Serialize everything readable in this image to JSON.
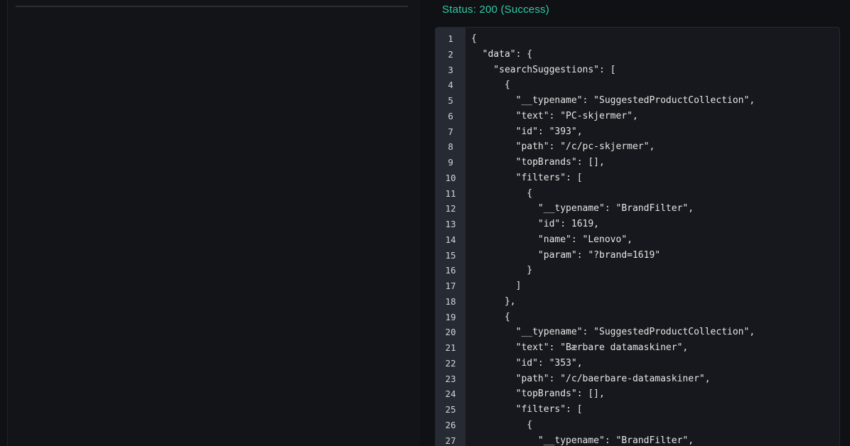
{
  "status": {
    "text": "Status: 200 (Success)",
    "color": "#33c9a5"
  },
  "editor": {
    "lines": [
      {
        "number": "1",
        "text": "{"
      },
      {
        "number": "2",
        "text": "  \"data\": {"
      },
      {
        "number": "3",
        "text": "    \"searchSuggestions\": ["
      },
      {
        "number": "4",
        "text": "      {"
      },
      {
        "number": "5",
        "text": "        \"__typename\": \"SuggestedProductCollection\","
      },
      {
        "number": "6",
        "text": "        \"text\": \"PC-skjermer\","
      },
      {
        "number": "7",
        "text": "        \"id\": \"393\","
      },
      {
        "number": "8",
        "text": "        \"path\": \"/c/pc-skjermer\","
      },
      {
        "number": "9",
        "text": "        \"topBrands\": [],"
      },
      {
        "number": "10",
        "text": "        \"filters\": ["
      },
      {
        "number": "11",
        "text": "          {"
      },
      {
        "number": "12",
        "text": "            \"__typename\": \"BrandFilter\","
      },
      {
        "number": "13",
        "text": "            \"id\": 1619,"
      },
      {
        "number": "14",
        "text": "            \"name\": \"Lenovo\","
      },
      {
        "number": "15",
        "text": "            \"param\": \"?brand=1619\""
      },
      {
        "number": "16",
        "text": "          }"
      },
      {
        "number": "17",
        "text": "        ]"
      },
      {
        "number": "18",
        "text": "      },"
      },
      {
        "number": "19",
        "text": "      {"
      },
      {
        "number": "20",
        "text": "        \"__typename\": \"SuggestedProductCollection\","
      },
      {
        "number": "21",
        "text": "        \"text\": \"Bærbare datamaskiner\","
      },
      {
        "number": "22",
        "text": "        \"id\": \"353\","
      },
      {
        "number": "23",
        "text": "        \"path\": \"/c/baerbare-datamaskiner\","
      },
      {
        "number": "24",
        "text": "        \"topBrands\": [],"
      },
      {
        "number": "25",
        "text": "        \"filters\": ["
      },
      {
        "number": "26",
        "text": "          {"
      },
      {
        "number": "27",
        "text": "            \"__typename\": \"BrandFilter\","
      }
    ]
  }
}
